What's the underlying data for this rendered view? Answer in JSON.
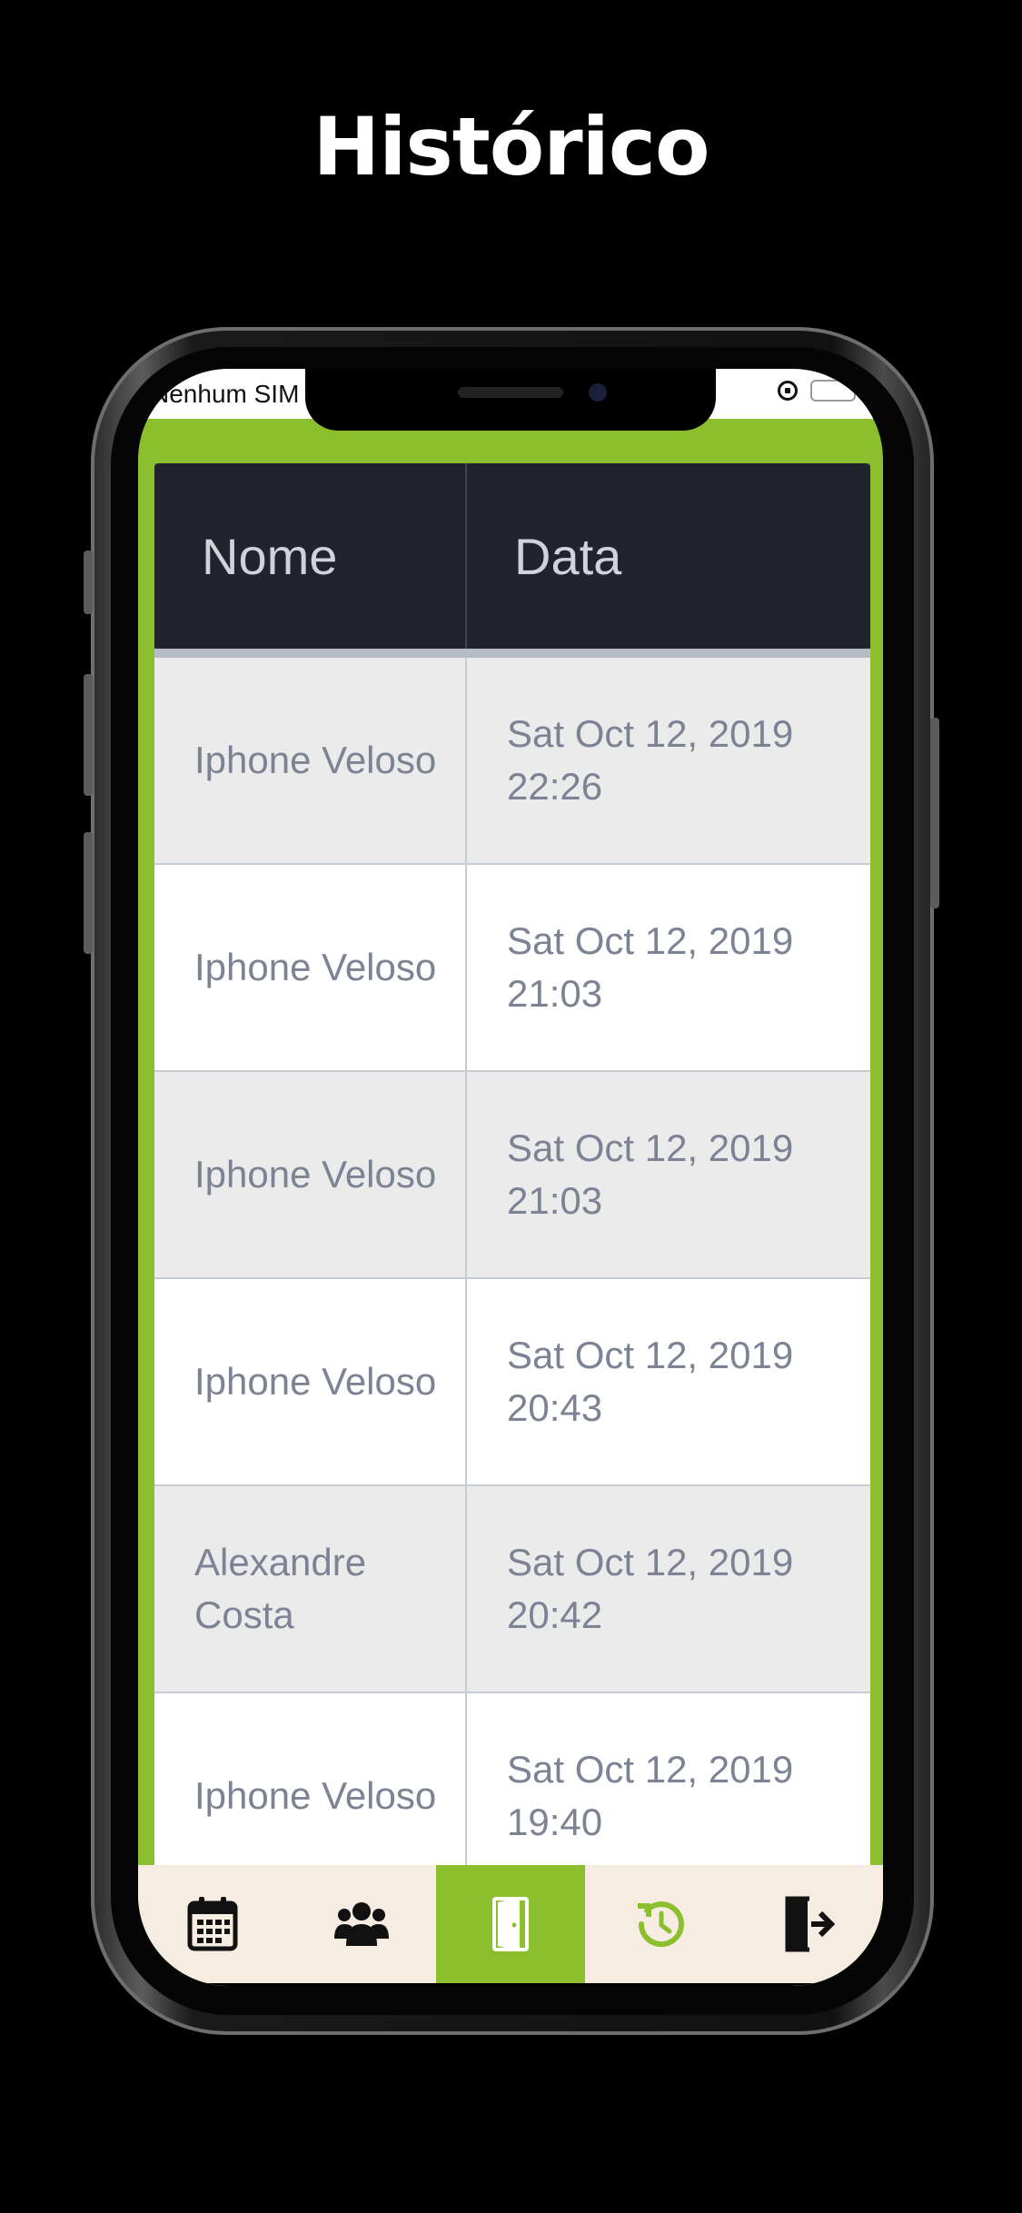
{
  "page_title": "Histórico",
  "status_bar": {
    "carrier": "Nenhum SIM",
    "battery_color": "#4cd964"
  },
  "table": {
    "headers": {
      "name": "Nome",
      "date": "Data"
    },
    "rows": [
      {
        "name": "Iphone Veloso",
        "date_line1": "Sat Oct 12, 2019",
        "date_line2": "22:26"
      },
      {
        "name": "Iphone Veloso",
        "date_line1": "Sat Oct 12, 2019",
        "date_line2": "21:03"
      },
      {
        "name": "Iphone Veloso",
        "date_line1": "Sat Oct 12, 2019",
        "date_line2": "21:03"
      },
      {
        "name": "Iphone Veloso",
        "date_line1": "Sat Oct 12, 2019",
        "date_line2": "20:43"
      },
      {
        "name_line1": "Alexandre",
        "name_line2": "Costa",
        "date_line1": "Sat Oct 12, 2019",
        "date_line2": "20:42"
      },
      {
        "name": "Iphone Veloso",
        "date_line1": "Sat Oct 12, 2019",
        "date_line2": "19:40"
      }
    ]
  },
  "tabbar": {
    "tabs": [
      {
        "icon": "calendar-icon"
      },
      {
        "icon": "users-icon"
      },
      {
        "icon": "door-icon",
        "active": true
      },
      {
        "icon": "history-icon"
      },
      {
        "icon": "logout-icon"
      }
    ],
    "accent_color": "#8bbf2e",
    "background_color": "#f6ece1"
  }
}
